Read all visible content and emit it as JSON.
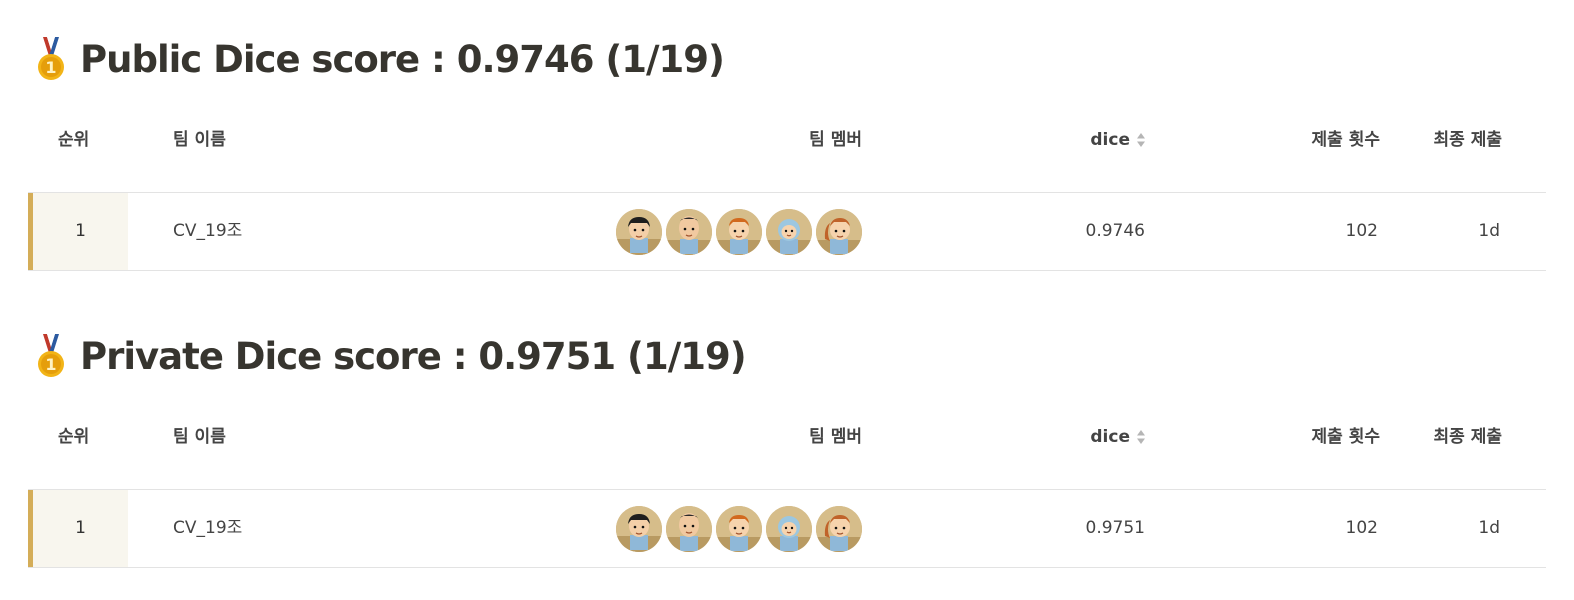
{
  "colors": {
    "accent": "#d4ad58",
    "rank_cell_bg": "#f8f6ee",
    "heading_text": "#37352f"
  },
  "sections": [
    {
      "heading": "Public Dice score : 0.9746 (1/19)",
      "icon": "medal-icon",
      "columns": {
        "rank": "순위",
        "team": "팀 이름",
        "members": "팀 멤버",
        "dice": "dice",
        "submissions": "제출 횟수",
        "final_submission": "최종 제출"
      },
      "rows": [
        {
          "rank": "1",
          "team": "CV_19조",
          "members_count": 5,
          "dice": "0.9746",
          "submissions": "102",
          "final_submission": "1d"
        }
      ]
    },
    {
      "heading": "Private Dice score : 0.9751 (1/19)",
      "icon": "medal-icon",
      "columns": {
        "rank": "순위",
        "team": "팀 이름",
        "members": "팀 멤버",
        "dice": "dice",
        "submissions": "제출 횟수",
        "final_submission": "최종 제출"
      },
      "rows": [
        {
          "rank": "1",
          "team": "CV_19조",
          "members_count": 5,
          "dice": "0.9751",
          "submissions": "102",
          "final_submission": "1d"
        }
      ]
    }
  ]
}
